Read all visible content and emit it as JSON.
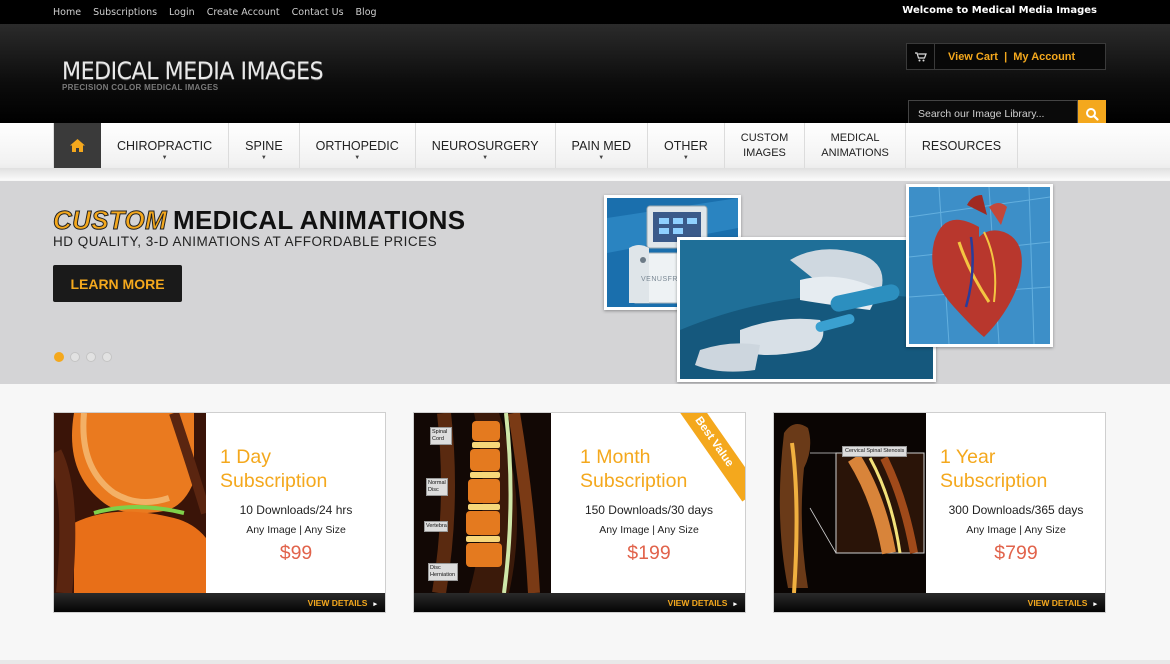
{
  "topbar": {
    "links": [
      "Home",
      "Subscriptions",
      "Login",
      "Create Account",
      "Contact Us",
      "Blog"
    ],
    "welcome": "Welcome to Medical Media Images"
  },
  "header": {
    "logo_main": "MEDICAL MEDIA IMAGES",
    "logo_sub": "PRECISION COLOR MEDICAL IMAGES",
    "view_cart": "View Cart",
    "separator": "|",
    "my_account": "My Account",
    "search_placeholder": "Search our Image Library..."
  },
  "nav": {
    "items": [
      {
        "label": "CHIROPRACTIC",
        "caret": "▼"
      },
      {
        "label": "SPINE",
        "caret": "▼"
      },
      {
        "label": "ORTHOPEDIC",
        "caret": "▼"
      },
      {
        "label": "NEUROSURGERY",
        "caret": "▼"
      },
      {
        "label": "PAIN MED",
        "caret": "▼"
      },
      {
        "label": "OTHER",
        "caret": "▼"
      }
    ],
    "custom_images": [
      "CUSTOM",
      "IMAGES"
    ],
    "medical_animations": [
      "MEDICAL",
      "ANIMATIONS"
    ],
    "resources": "RESOURCES"
  },
  "banner": {
    "title_highlight": "CUSTOM",
    "title_rest": "MEDICAL ANIMATIONS",
    "subtitle": "HD QUALITY, 3-D ANIMATIONS AT AFFORDABLE PRICES",
    "button": "LEARN MORE",
    "device_brand": "VENUSFREEZE"
  },
  "cards": [
    {
      "title1": "1 Day",
      "title2": "Subscription",
      "downloads": "10 Downloads/24 hrs",
      "any": "Any Image | Any Size",
      "price": "$99",
      "details": "VIEW DETAILS"
    },
    {
      "title1": "1 Month",
      "title2": "Subscription",
      "downloads": "150 Downloads/30 days",
      "any": "Any Image | Any Size",
      "price": "$199",
      "details": "VIEW DETAILS",
      "ribbon": "Best Value",
      "labels": [
        "Spinal Cord",
        "Normal Disc",
        "Vertebra",
        "Disc Herniation"
      ]
    },
    {
      "title1": "1 Year",
      "title2": "Subscription",
      "downloads": "300 Downloads/365 days",
      "any": "Any Image | Any Size",
      "price": "$799",
      "details": "VIEW DETAILS",
      "labels": [
        "Cervical Spinal Stenosis"
      ]
    }
  ],
  "colors": {
    "accent": "#f4a81d",
    "price": "#e1634b"
  }
}
